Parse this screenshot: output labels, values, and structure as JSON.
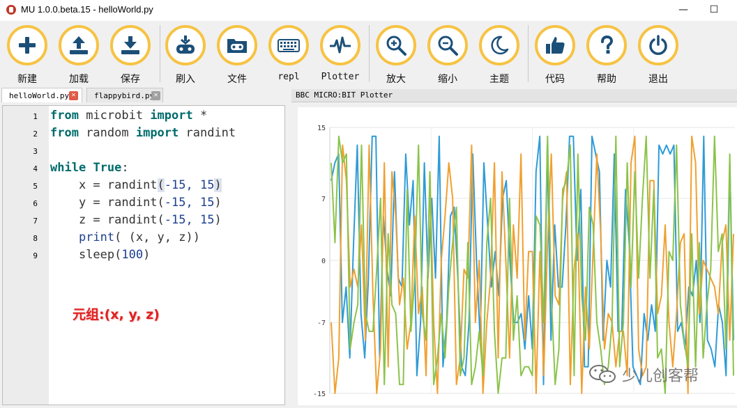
{
  "window": {
    "title": "MU 1.0.0.beta.15 - helloWorld.py",
    "minimize": "—",
    "maximize": "☐"
  },
  "toolbar": {
    "buttons": [
      {
        "id": "new",
        "label": "新建",
        "icon": "plus-icon"
      },
      {
        "id": "load",
        "label": "加载",
        "icon": "upload-icon"
      },
      {
        "id": "save",
        "label": "保存",
        "icon": "download-icon"
      },
      {
        "id": "flash",
        "label": "刷入",
        "icon": "flash-icon"
      },
      {
        "id": "files",
        "label": "文件",
        "icon": "folder-icon"
      },
      {
        "id": "repl",
        "label": "repl",
        "icon": "keyboard-icon"
      },
      {
        "id": "plotter",
        "label": "Plotter",
        "icon": "pulse-icon"
      },
      {
        "id": "zoomin",
        "label": "放大",
        "icon": "zoom-in-icon"
      },
      {
        "id": "zoomout",
        "label": "缩小",
        "icon": "zoom-out-icon"
      },
      {
        "id": "theme",
        "label": "主题",
        "icon": "moon-icon"
      },
      {
        "id": "check",
        "label": "代码",
        "icon": "thumbs-up-icon"
      },
      {
        "id": "help",
        "label": "帮助",
        "icon": "question-icon"
      },
      {
        "id": "quit",
        "label": "退出",
        "icon": "power-icon"
      }
    ]
  },
  "tabs": [
    {
      "name": "helloWorld.py",
      "active": true,
      "close": "✕"
    },
    {
      "name": "flappybird.py",
      "active": false,
      "close": "✕"
    }
  ],
  "editor": {
    "line_numbers": [
      "1",
      "2",
      "3",
      "4",
      "5",
      "6",
      "7",
      "8",
      "9"
    ],
    "lines": [
      {
        "indent": "",
        "parts": [
          [
            "from",
            "kw"
          ],
          [
            " microbit ",
            ""
          ],
          [
            "import",
            "kw"
          ],
          [
            " *",
            ""
          ]
        ]
      },
      {
        "indent": "",
        "parts": [
          [
            "from",
            "kw"
          ],
          [
            " random ",
            ""
          ],
          [
            "import",
            "kw"
          ],
          [
            " randint",
            ""
          ]
        ]
      },
      {
        "indent": "",
        "parts": []
      },
      {
        "indent": "",
        "parts": [
          [
            "while",
            "kw"
          ],
          [
            " ",
            ""
          ],
          [
            "True",
            "kw"
          ],
          [
            ":",
            ""
          ]
        ]
      },
      {
        "indent": "    ",
        "parts": [
          [
            "x = randint",
            ""
          ],
          [
            "(",
            "hl"
          ],
          [
            "-15, 15",
            "nm"
          ],
          [
            ")",
            "hl"
          ]
        ]
      },
      {
        "indent": "    ",
        "parts": [
          [
            "y = randint(",
            ""
          ],
          [
            "-15, 15",
            "nm"
          ],
          [
            ")",
            ""
          ]
        ]
      },
      {
        "indent": "    ",
        "parts": [
          [
            "z = randint(",
            ""
          ],
          [
            "-15, 15",
            "nm"
          ],
          [
            ")",
            ""
          ]
        ]
      },
      {
        "indent": "    ",
        "parts": [
          [
            "print",
            "nm"
          ],
          [
            "( (x, y, z))",
            ""
          ]
        ]
      },
      {
        "indent": "    ",
        "parts": [
          [
            "sleep(",
            ""
          ],
          [
            "100",
            "nm"
          ],
          [
            ")",
            ""
          ]
        ]
      }
    ],
    "annotation": "元组:(x, y, z)"
  },
  "plotter": {
    "header": "BBC MICRO:BIT Plotter",
    "watermark": "少儿创客帮"
  },
  "chart_data": {
    "type": "line",
    "title": "",
    "xlabel": "",
    "ylabel": "",
    "ylim": [
      -15,
      15
    ],
    "yticks": [
      "15",
      "7",
      "0",
      "-7",
      "-15"
    ],
    "grid": true,
    "series": [
      {
        "color": "#2e9bd6",
        "values": [
          9,
          11,
          12,
          -7,
          -3,
          -11,
          2,
          13,
          -6,
          -11,
          -2,
          14,
          14,
          -11,
          5,
          -1,
          -4,
          10,
          -2,
          -3,
          12,
          4,
          9,
          -13,
          -7,
          11,
          -2,
          7,
          -2,
          14,
          -12,
          -7,
          5,
          6,
          -2,
          -12,
          -13,
          -7,
          12,
          0,
          -9,
          11,
          4,
          -3,
          1,
          -4,
          7,
          9,
          0,
          -7,
          -7,
          -6,
          -10,
          -4,
          -10,
          10,
          14,
          -14,
          13,
          -9,
          4,
          -3,
          -3,
          4,
          14,
          14,
          0,
          8,
          -12,
          -12,
          14,
          12,
          10,
          -9,
          0,
          -3,
          12,
          -8,
          -8,
          8,
          2,
          -12,
          -13,
          -14,
          -6,
          -9,
          -5,
          -8,
          13,
          12,
          13,
          12,
          13,
          -8,
          -7,
          -10,
          -3,
          -4,
          0,
          -7,
          14,
          -9,
          -10,
          -12,
          -5,
          -7,
          -13,
          11,
          -9
        ]
      },
      {
        "color": "#f0a030",
        "values": [
          -7,
          -15,
          -11,
          13,
          9,
          -3,
          -1,
          -3,
          4,
          -9,
          13,
          -4,
          -15,
          -10,
          11,
          -12,
          10,
          5,
          -5,
          -2,
          -10,
          -7,
          5,
          -6,
          -3,
          -13,
          10,
          -7,
          -15,
          0,
          5,
          11,
          7,
          -14,
          -11,
          -1,
          -2,
          13,
          -7,
          0,
          -15,
          -7,
          -2,
          11,
          -11,
          10,
          0,
          -11,
          4,
          -2,
          12,
          -9,
          1,
          1,
          -15,
          1,
          -13,
          2,
          12,
          -4,
          -5,
          7,
          10,
          -14,
          -1,
          3,
          -15,
          -3,
          -10,
          1,
          12,
          3,
          -10,
          -6,
          -7,
          -12,
          -8,
          -8,
          -13,
          11,
          14,
          -10,
          -13,
          -12,
          9,
          9,
          -6,
          -4,
          4,
          -7,
          -12,
          -6,
          2,
          3,
          -15,
          14,
          11,
          -6,
          0,
          -1,
          -2,
          -3,
          -6,
          2,
          4,
          -9,
          3
        ]
      },
      {
        "color": "#8bc34a",
        "values": [
          11,
          2,
          14,
          11,
          12,
          -10,
          -7,
          -5,
          13,
          -6,
          -8,
          -8,
          -1,
          7,
          -14,
          3,
          -5,
          -6,
          -14,
          -14,
          8,
          -8,
          -2,
          13,
          -6,
          -9,
          10,
          -14,
          -11,
          -6,
          -11,
          -3,
          2,
          6,
          -13,
          -11,
          2,
          -14,
          -12,
          -8,
          -13,
          2,
          7,
          -8,
          -15,
          -11,
          -11,
          7,
          -9,
          -4,
          -13,
          -12,
          -12,
          -13,
          5,
          4,
          -7,
          14,
          -4,
          -14,
          -10,
          8,
          9,
          13,
          -13,
          12,
          -4,
          -9,
          6,
          4,
          -7,
          -10,
          -14,
          -12,
          -7,
          14,
          -12,
          -7,
          11,
          -3,
          10,
          -2,
          7,
          14,
          -2,
          8,
          -11,
          -10,
          -15,
          1,
          0,
          13,
          -5,
          -9,
          -12,
          3,
          -12,
          2,
          -11,
          -5,
          -1,
          14,
          1,
          3,
          -10,
          12,
          -13
        ]
      }
    ]
  }
}
